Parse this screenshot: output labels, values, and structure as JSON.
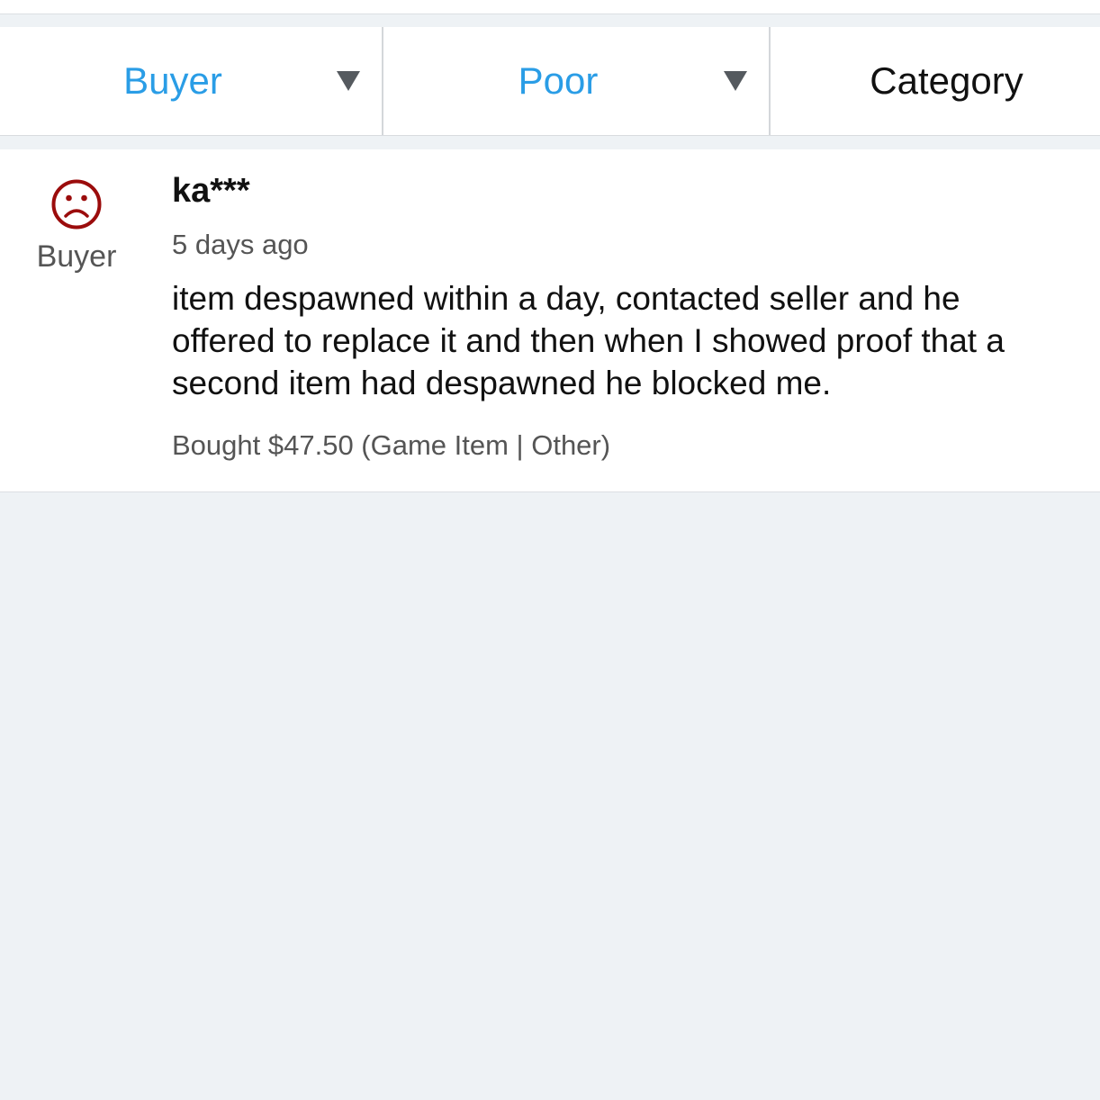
{
  "filters": {
    "role": {
      "label": "Buyer",
      "icon": "caret-down-icon"
    },
    "rating": {
      "label": "Poor",
      "icon": "caret-down-icon"
    },
    "category": {
      "label": "Category"
    }
  },
  "review": {
    "rating_icon": "sad-face-icon",
    "rating_color": "#9b0c0c",
    "role": "Buyer",
    "username": "ka***",
    "time_ago": "5 days ago",
    "text_lines": [
      "item despawned within a day, contacted seller and he",
      "offered to replace it and then when I showed proof that a",
      "second item had despawned he blocked me."
    ],
    "purchase_info": "Bought $47.50 (Game Item | Other)"
  },
  "colors": {
    "accent": "#2a9de6",
    "background": "#eef2f5",
    "negative": "#9b0c0c"
  }
}
